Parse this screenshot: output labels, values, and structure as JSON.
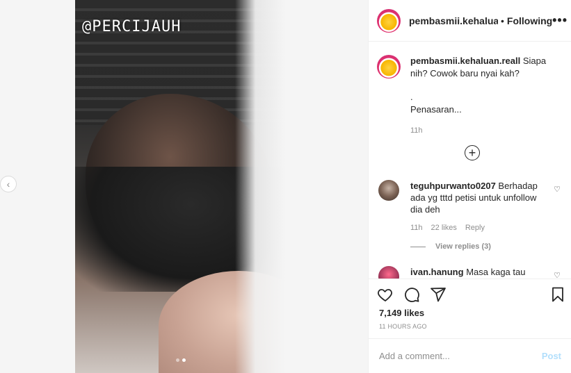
{
  "media": {
    "watermark": "@PERCIJAUH",
    "carousel_dots": 2,
    "carousel_active": 2
  },
  "header": {
    "username": "pembasmii.kehaluan.r",
    "separator": "•",
    "follow_label": "Following",
    "more": "•••"
  },
  "caption": {
    "username": "pembasmii.kehaluan.reall",
    "text_line1": "Siapa nih? Cowok baru nyai kah?",
    "dot_line": ".",
    "text_line2": "Penasaran...",
    "time": "11h",
    "load_more": "+"
  },
  "comments": [
    {
      "username": "teguhpurwanto0207",
      "text": "Berhadap ada yg tttd petisi untuk unfollow dia deh",
      "time": "11h",
      "likes": "22 likes",
      "reply": "Reply",
      "view_replies": "View replies (3)"
    },
    {
      "username": "ivan.hanung",
      "text": "Masa kaga tau gofar"
    }
  ],
  "actions": {
    "likes": "7,149 likes",
    "time": "11 HOURS AGO"
  },
  "add_comment": {
    "placeholder": "Add a comment...",
    "post_label": "Post"
  },
  "colors": {
    "text": "#262626",
    "muted": "#8e8e8e",
    "post_disabled": "#b2dffc",
    "border": "#efefef"
  }
}
